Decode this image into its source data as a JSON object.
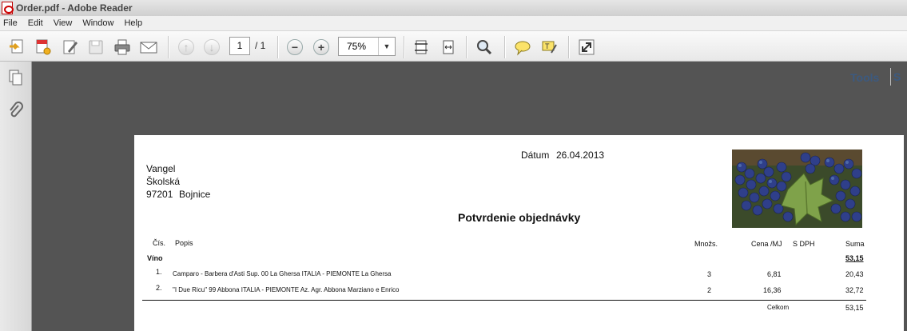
{
  "window": {
    "title": "Order.pdf - Adobe Reader"
  },
  "menu": [
    "File",
    "Edit",
    "View",
    "Window",
    "Help"
  ],
  "toolbar": {
    "current_page": "1",
    "page_total": "/ 1",
    "zoom": "75%",
    "tools_label": "Tools",
    "right_truncated": "S"
  },
  "document": {
    "date_label": "Dátum",
    "date_value": "26.04.2013",
    "customer": {
      "name": "Vangel",
      "street": "Školská",
      "zip": "97201",
      "city": "Bojnice"
    },
    "heading": "Potvrdenie objednávky",
    "columns": {
      "no": "Čís.",
      "desc": "Popis",
      "qty": "Množs.",
      "price": "Cena /MJ",
      "vat": "S DPH",
      "sum": "Suma"
    },
    "category": {
      "name": "Víno",
      "sum": "53,15"
    },
    "items": [
      {
        "no": "1.",
        "desc": "Camparo - Barbera d'Asti Sup. 00 La Ghersa ITALIA - PIEMONTE La Ghersa",
        "qty": "3",
        "price": "6,81",
        "sum": "20,43"
      },
      {
        "no": "2.",
        "desc": "\"I Due Ricu\" 99 Abbona ITALIA - PIEMONTE Az. Agr. Abbona Marziano e Enrico",
        "qty": "2",
        "price": "16,36",
        "sum": "32,72"
      }
    ],
    "total": {
      "label": "Celkom",
      "value": "53,15"
    }
  }
}
